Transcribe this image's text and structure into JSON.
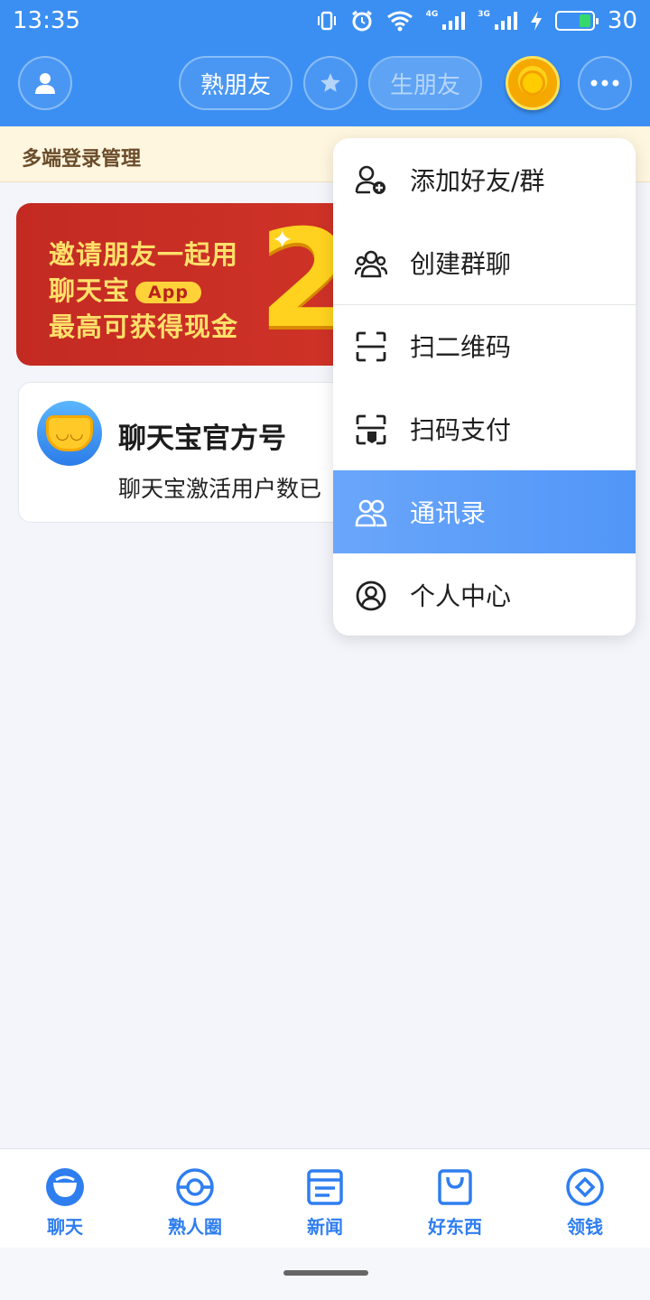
{
  "status_bar": {
    "time": "13:35",
    "signal1_tag": "4G",
    "signal2_tag": "3G",
    "battery_level": "30",
    "icons": [
      "vibrate-icon",
      "alarm-icon",
      "wifi-icon",
      "signal-icon",
      "signal-icon",
      "charging-icon",
      "battery-icon"
    ]
  },
  "header": {
    "profile_icon": "person-icon",
    "tab_familiar": "熟朋友",
    "star_icon": "star-icon",
    "tab_stranger": "生朋友",
    "coin_icon": "coin-icon",
    "more_icon": "more-icon"
  },
  "notice": {
    "text": "多端登录管理"
  },
  "banner": {
    "line1": "邀请朋友一起用",
    "line2": "聊天宝",
    "app_tag": "App",
    "line3": "最高可获得现金",
    "amount_visible": "2"
  },
  "chat_card": {
    "title": "聊天宝官方号",
    "preview": "聊天宝激活用户数已"
  },
  "menu": {
    "items": [
      {
        "label": "添加好友/群",
        "icon": "add-friend-icon"
      },
      {
        "label": "创建群聊",
        "icon": "group-chat-icon"
      },
      {
        "label": "扫二维码",
        "icon": "scan-icon"
      },
      {
        "label": "扫码支付",
        "icon": "scan-pay-icon"
      },
      {
        "label": "通讯录",
        "icon": "contacts-icon"
      },
      {
        "label": "个人中心",
        "icon": "profile-icon"
      }
    ],
    "active_index": 4
  },
  "bottom_nav": {
    "items": [
      {
        "label": "聊天",
        "icon": "chat-icon"
      },
      {
        "label": "熟人圈",
        "icon": "circle-icon"
      },
      {
        "label": "新闻",
        "icon": "news-icon"
      },
      {
        "label": "好东西",
        "icon": "shop-icon"
      },
      {
        "label": "领钱",
        "icon": "money-icon"
      }
    ]
  },
  "colors": {
    "header": "#3b8ff2",
    "accent": "#2f7ef0",
    "menu_active": "#5c9ef8",
    "banner": "#d0322a"
  }
}
